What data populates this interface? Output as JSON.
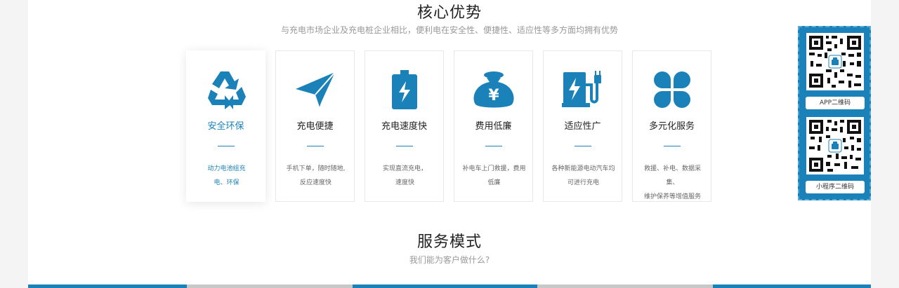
{
  "advantages": {
    "title": "核心优势",
    "subtitle": "与充电市场企业及充电桩企业相比，便利电在安全性、便捷性、适应性等多方面均拥有优势",
    "cards": [
      {
        "name": "安全环保",
        "desc_line1": "动力电池组充",
        "desc_line2": "电、环保",
        "icon": "recycle-icon"
      },
      {
        "name": "充电便捷",
        "desc_line1": "手机下单，随时随地,",
        "desc_line2": "反应速度快",
        "icon": "paper-plane-icon"
      },
      {
        "name": "充电速度快",
        "desc_line1": "实现直流充电，",
        "desc_line2": "速度快",
        "icon": "battery-bolt-icon"
      },
      {
        "name": "费用低廉",
        "desc_line1": "补电车上门救援，费用",
        "desc_line2": "低廉",
        "icon": "money-bag-icon"
      },
      {
        "name": "适应性广",
        "desc_line1": "各种新能源电动汽车均",
        "desc_line2": "可进行充电",
        "icon": "charging-station-icon"
      },
      {
        "name": "多元化服务",
        "desc_line1": "救援、补电、数据采集、",
        "desc_line2": "维护保养等增值服务",
        "icon": "four-petal-icon"
      }
    ]
  },
  "services": {
    "title": "服务模式",
    "subtitle": "我们能为客户做什么?"
  },
  "qr_panel": {
    "app_label": "APP二维码",
    "mini_label": "小程序二维码"
  },
  "colors": {
    "accent": "#1a82b8",
    "text": "#222222",
    "muted": "#999999"
  }
}
